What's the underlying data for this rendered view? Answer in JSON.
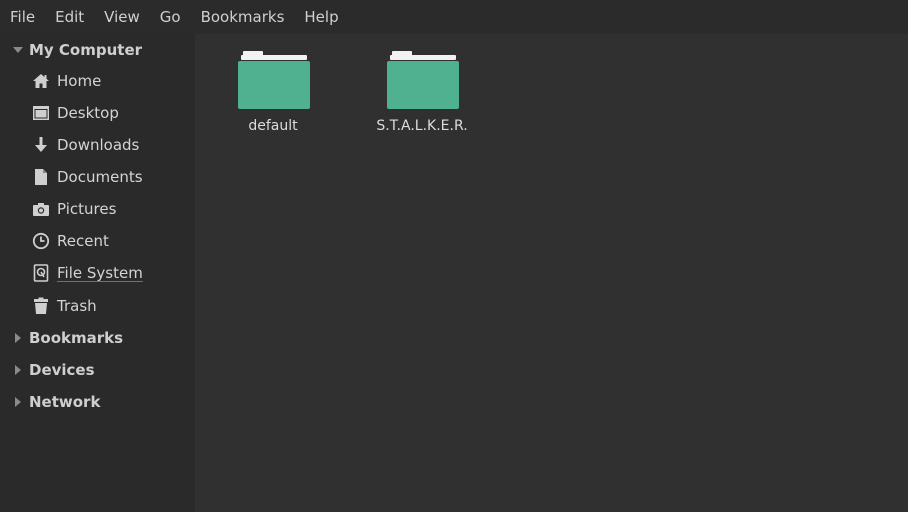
{
  "menubar": {
    "items": [
      "File",
      "Edit",
      "View",
      "Go",
      "Bookmarks",
      "Help"
    ]
  },
  "sidebar": {
    "my_computer": {
      "label": "My Computer",
      "expanded": true,
      "items": [
        {
          "label": "Home",
          "icon": "home-icon"
        },
        {
          "label": "Desktop",
          "icon": "desktop-icon"
        },
        {
          "label": "Downloads",
          "icon": "download-icon"
        },
        {
          "label": "Documents",
          "icon": "document-icon"
        },
        {
          "label": "Pictures",
          "icon": "camera-icon"
        },
        {
          "label": "Recent",
          "icon": "clock-icon"
        },
        {
          "label": "File System",
          "icon": "drive-icon"
        },
        {
          "label": "Trash",
          "icon": "trash-icon"
        }
      ]
    },
    "sections": [
      {
        "label": "Bookmarks",
        "expanded": false
      },
      {
        "label": "Devices",
        "expanded": false
      },
      {
        "label": "Network",
        "expanded": false
      }
    ]
  },
  "content": {
    "files": [
      {
        "name": "default",
        "icon": "folder-icon"
      },
      {
        "name": "S.T.A.L.K.E.R.",
        "icon": "folder-icon"
      }
    ]
  },
  "colors": {
    "folder": "#4fb18f",
    "folder_tab": "#f2f2f2",
    "background": "#303030",
    "sidebar": "#2a2a2a",
    "accent_underline": "#d9405a"
  }
}
